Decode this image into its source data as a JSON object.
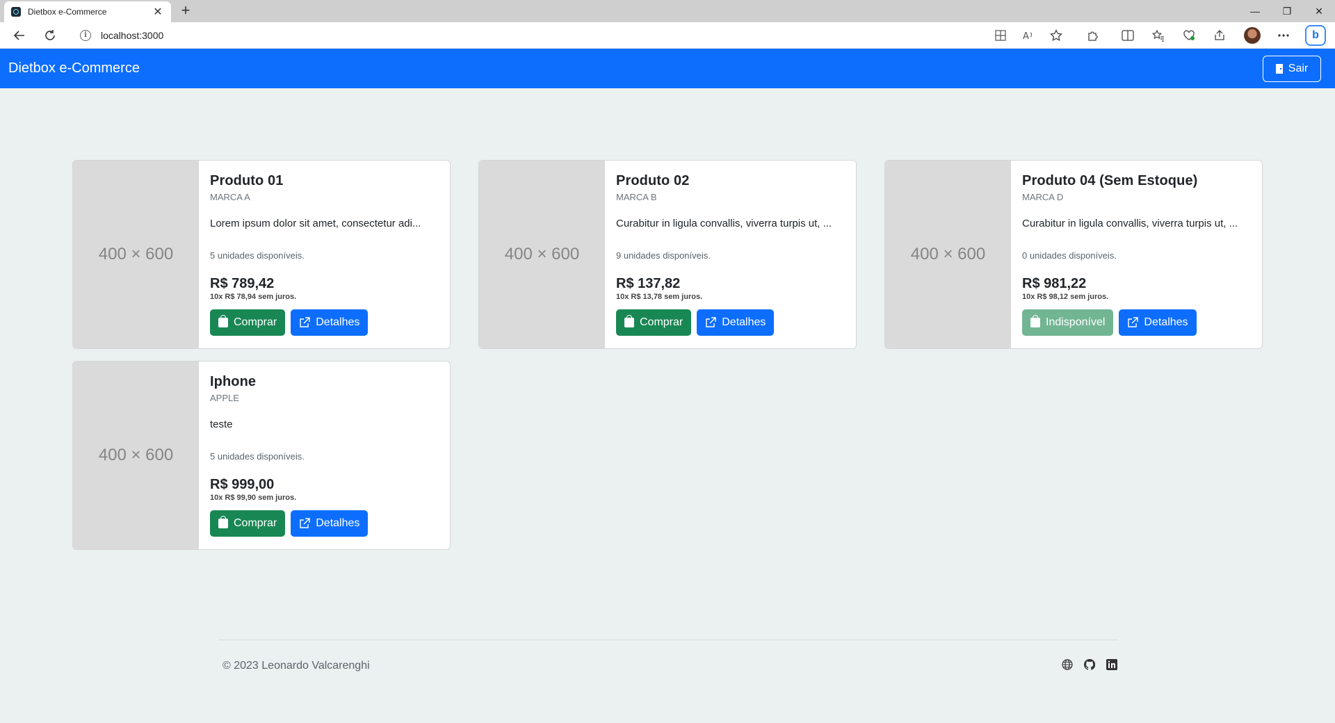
{
  "browser": {
    "tab_title": "Dietbox e-Commerce",
    "tab_close": "✕",
    "new_tab": "+",
    "url": "localhost:3000",
    "window_controls": [
      "—",
      "❐",
      "✕"
    ]
  },
  "navbar": {
    "brand": "Dietbox e-Commerce",
    "logout_label": "Sair"
  },
  "products": [
    {
      "image_placeholder": "400 × 600",
      "name": "Produto 01",
      "brand": "MARCA A",
      "description": "Lorem ipsum dolor sit amet, consectetur adi...",
      "stock": "5 unidades disponíveis.",
      "price": "R$ 789,42",
      "installments": "10x R$ 78,94 sem juros.",
      "buy_label": "Comprar",
      "details_label": "Detalhes",
      "available": true
    },
    {
      "image_placeholder": "400 × 600",
      "name": "Produto 02",
      "brand": "MARCA B",
      "description": "Curabitur in ligula convallis, viverra turpis ut, ...",
      "stock": "9 unidades disponíveis.",
      "price": "R$ 137,82",
      "installments": "10x R$ 13,78 sem juros.",
      "buy_label": "Comprar",
      "details_label": "Detalhes",
      "available": true
    },
    {
      "image_placeholder": "400 × 600",
      "name": "Produto 04 (Sem Estoque)",
      "brand": "MARCA D",
      "description": "Curabitur in ligula convallis, viverra turpis ut, ...",
      "stock": "0 unidades disponíveis.",
      "price": "R$ 981,22",
      "installments": "10x R$ 98,12 sem juros.",
      "buy_label": "Indisponível",
      "details_label": "Detalhes",
      "available": false
    },
    {
      "image_placeholder": "400 × 600",
      "name": "Iphone",
      "brand": "APPLE",
      "description": "teste",
      "stock": "5 unidades disponíveis.",
      "price": "R$ 999,00",
      "installments": "10x R$ 99,90 sem juros.",
      "buy_label": "Comprar",
      "details_label": "Detalhes",
      "available": true
    }
  ],
  "footer": {
    "copyright": "© 2023 Leonardo Valcarenghi",
    "social_icons": [
      "globe-icon",
      "github-icon",
      "linkedin-icon"
    ]
  },
  "colors": {
    "primary": "#0d6efd",
    "success": "#198754",
    "success_disabled": "#72b593",
    "page_bg": "#ebf1f1"
  }
}
